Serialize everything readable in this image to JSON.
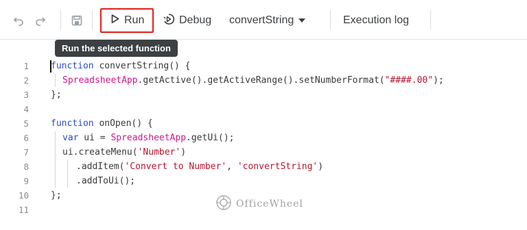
{
  "toolbar": {
    "undo_icon": "undo-icon",
    "redo_icon": "redo-icon",
    "save_icon": "save-icon",
    "run_label": "Run",
    "debug_label": "Debug",
    "function_selector": "convertString",
    "execution_log_label": "Execution log"
  },
  "tooltip": {
    "text": "Run the selected function"
  },
  "editor": {
    "line_numbers": [
      "1",
      "2",
      "3",
      "4",
      "5",
      "6",
      "7",
      "8",
      "9",
      "10",
      "11"
    ],
    "lines": {
      "l1_kw": "function",
      "l1_rest": " convertString() {",
      "l2_cls": "SpreadsheetApp",
      "l2_mid": ".getActive().getActiveRange().setNumberFormat(",
      "l2_str": "\"####.00\"",
      "l2_end": ");",
      "l3": "};",
      "l5_kw": "function",
      "l5_rest": " onOpen() {",
      "l6_kw": "var",
      "l6_mid": " ui = ",
      "l6_cls": "SpreadsheetApp",
      "l6_end": ".getUi();",
      "l7_start": "ui.createMenu(",
      "l7_str": "'Number'",
      "l7_end": ")",
      "l8_start": ".addItem(",
      "l8_str1": "'Convert to Number'",
      "l8_mid": ", ",
      "l8_str2": "'convertString'",
      "l8_end": ")",
      "l9": ".addToUi();",
      "l10": "};"
    }
  },
  "watermark": {
    "text": "OfficeWheel"
  },
  "colors": {
    "keyword": "#2a4dd0",
    "class_name": "#d1178a",
    "string": "#b3182f",
    "highlight_border": "#e0201c"
  }
}
